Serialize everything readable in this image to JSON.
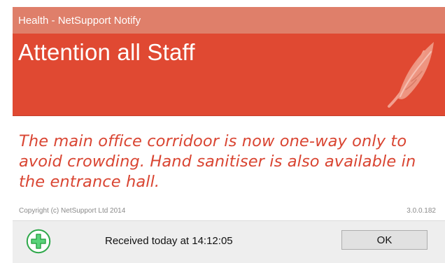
{
  "window": {
    "title": "Health - NetSupport Notify"
  },
  "header": {
    "title": "Attention all Staff",
    "icon": "feather-icon"
  },
  "message": {
    "text": "The main office corridoor is now one-way only to avoid crowding. Hand sanitiser is also available in the entrance hall."
  },
  "footer": {
    "copyright": "Copyright (c) NetSupport Ltd 2014",
    "version": "3.0.0.182",
    "received_text": "Received today at 14:12:05",
    "ok_label": "OK",
    "status_icon": "plus-circle-icon"
  },
  "colors": {
    "titlebar": "#df7f6a",
    "header": "#e04932",
    "message_text": "#d94532",
    "icon_green": "#2ea84a"
  }
}
